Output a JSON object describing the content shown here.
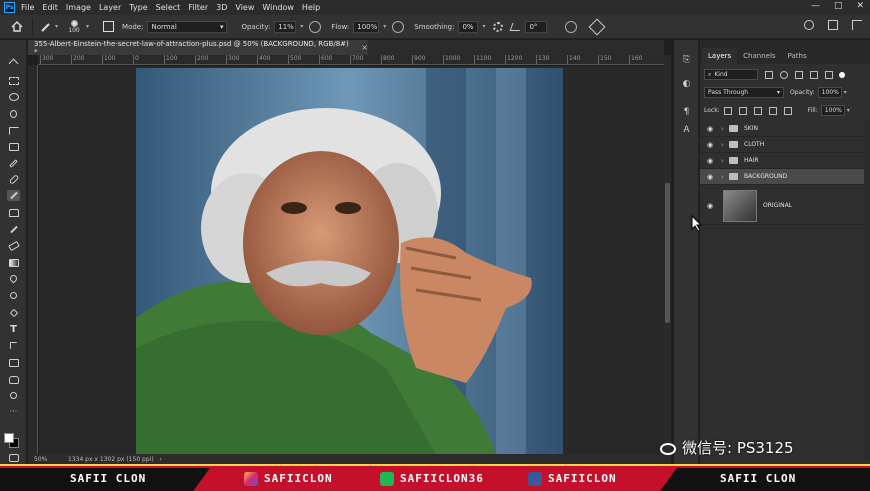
{
  "menubar": {
    "logo": "Ps",
    "items": [
      "File",
      "Edit",
      "Image",
      "Layer",
      "Type",
      "Select",
      "Filter",
      "3D",
      "View",
      "Window",
      "Help"
    ],
    "window_controls": [
      "—",
      "□",
      "✕"
    ]
  },
  "options": {
    "brush_size": "100",
    "mode_label": "Mode:",
    "mode_value": "Normal",
    "opacity_label": "Opacity:",
    "opacity_value": "11%",
    "flow_label": "Flow:",
    "flow_value": "100%",
    "smoothing_label": "Smoothing:",
    "smoothing_value": "0%",
    "angle_value": "0°"
  },
  "document": {
    "tab_title": "355-Albert-Einstein-the-secret-law-of-attraction-plus.psd @ 50% (BACKGROUND, RGB/8#) *",
    "close": "×",
    "ruler_ticks": [
      "300",
      "200",
      "100",
      "0",
      "100",
      "200",
      "300",
      "400",
      "500",
      "600",
      "700",
      "800",
      "900",
      "1000",
      "1100",
      "1200",
      "130",
      "140",
      "150",
      "160"
    ],
    "zoom": "50%",
    "doc_info": "1334 px x 1302 px (150 ppi)"
  },
  "panel": {
    "tabs": [
      "Layers",
      "Channels",
      "Paths"
    ],
    "filter_kind": "Kind",
    "blend_mode": "Pass Through",
    "opacity_label": "Opacity:",
    "opacity_value": "100%",
    "lock_label": "Lock:",
    "fill_label": "Fill:",
    "fill_value": "100%",
    "layers": [
      {
        "name": "SKIN",
        "type": "group",
        "selected": false
      },
      {
        "name": "CLOTH",
        "type": "group",
        "selected": false
      },
      {
        "name": "HAIR",
        "type": "group",
        "selected": false
      },
      {
        "name": "BACKGROUND",
        "type": "group",
        "selected": true
      },
      {
        "name": "ORIGINAL",
        "type": "image",
        "selected": false
      }
    ]
  },
  "banner": {
    "left_text": "SAFII CLON",
    "instagram": "SAFIICLON",
    "other": "SAFIICLON36",
    "facebook": "SAFIICLON",
    "right_text": "SAFII CLON"
  },
  "watermark": "微信号: PS3125",
  "colors": {
    "banner_red": "#c4102a",
    "accent_blue": "#31a8ff"
  }
}
